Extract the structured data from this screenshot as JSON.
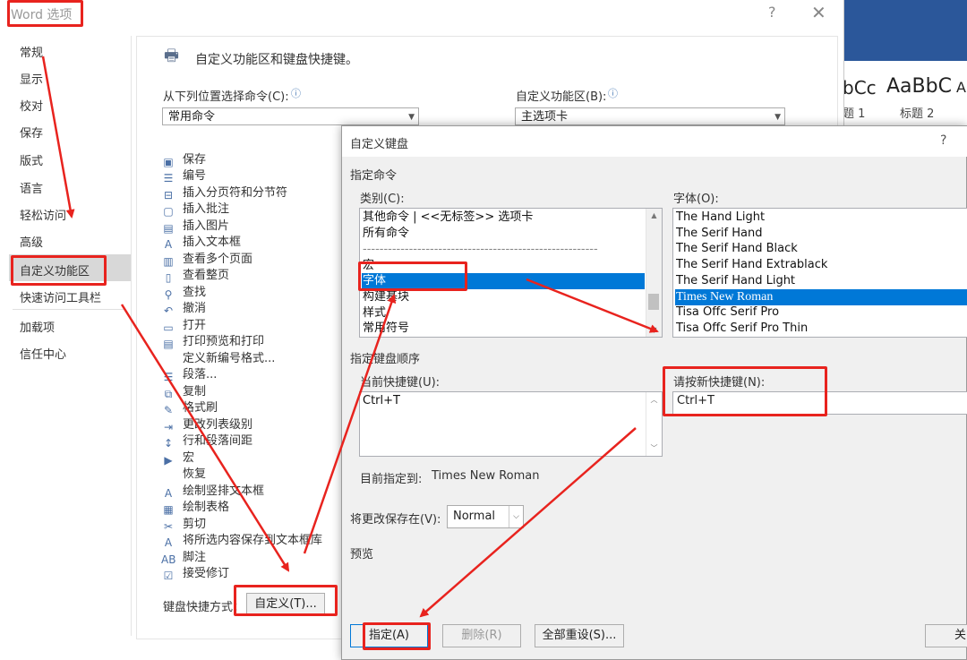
{
  "word_bg": {
    "style_sample_1": "bCc",
    "style_sample_2": "AaBbC",
    "style_sample_3": "A",
    "style_name_1": "题 1",
    "style_name_2": "标题 2"
  },
  "options_dialog": {
    "title": "Word 选项",
    "help": "?",
    "close": "✕",
    "nav": [
      "常规",
      "显示",
      "校对",
      "保存",
      "版式",
      "语言",
      "轻松访问",
      "高级",
      "自定义功能区",
      "快速访问工具栏",
      "加载项",
      "信任中心"
    ],
    "header": "自定义功能区和键盘快捷键。",
    "choose_from_label": "从下列位置选择命令(C):",
    "choose_from_value": "常用命令",
    "customize_ribbon_label": "自定义功能区(B):",
    "customize_ribbon_value": "主选项卡",
    "commands": [
      "保存",
      "编号",
      "插入分页符和分节符",
      "插入批注",
      "插入图片",
      "插入文本框",
      "查看多个页面",
      "查看整页",
      "查找",
      "撤消",
      "打开",
      "打印预览和打印",
      "定义新编号格式...",
      "段落...",
      "复制",
      "格式刷",
      "更改列表级别",
      "行和段落间距",
      "宏",
      "恢复",
      "绘制竖排文本框",
      "绘制表格",
      "剪切",
      "将所选内容保存到文本框库",
      "脚注",
      "接受修订"
    ],
    "shortcut_label": "键盘快捷方式：",
    "customize_button": "自定义(T)..."
  },
  "keyboard_dialog": {
    "title": "自定义键盘",
    "help": "?",
    "specify_command": "指定命令",
    "category_label": "类别(C):",
    "categories": [
      "其他命令 | <<无标签>> 选项卡",
      "所有命令",
      "--------------------------------------------------------",
      "宏",
      "字体",
      "构建基块",
      "样式",
      "常用符号"
    ],
    "category_selected": "字体",
    "font_label": "字体(O):",
    "fonts": [
      "The Hand Light",
      "The Serif Hand",
      "The Serif Hand Black",
      "The Serif Hand Extrablack",
      "The Serif Hand Light",
      "Times New Roman",
      "Tisa Offc Serif Pro",
      "Tisa Offc Serif Pro Thin"
    ],
    "font_selected": "Times New Roman",
    "key_sequence": "指定键盘顺序",
    "current_keys_label": "当前快捷键(U):",
    "current_keys_value": "Ctrl+T",
    "new_key_label": "请按新快捷键(N):",
    "new_key_value": "Ctrl+T",
    "assigned_to_label": "目前指定到:",
    "assigned_to_value": "Times New Roman",
    "save_in_label": "将更改保存在(V):",
    "save_in_value": "Normal",
    "preview_label": "预览",
    "assign_button": "指定(A)",
    "remove_button": "删除(R)",
    "reset_all_button": "全部重设(S)...",
    "close_button": "关"
  },
  "colors": {
    "annotation": "#e8231e",
    "selection": "#0078d7",
    "ribbon": "#2b579a"
  }
}
